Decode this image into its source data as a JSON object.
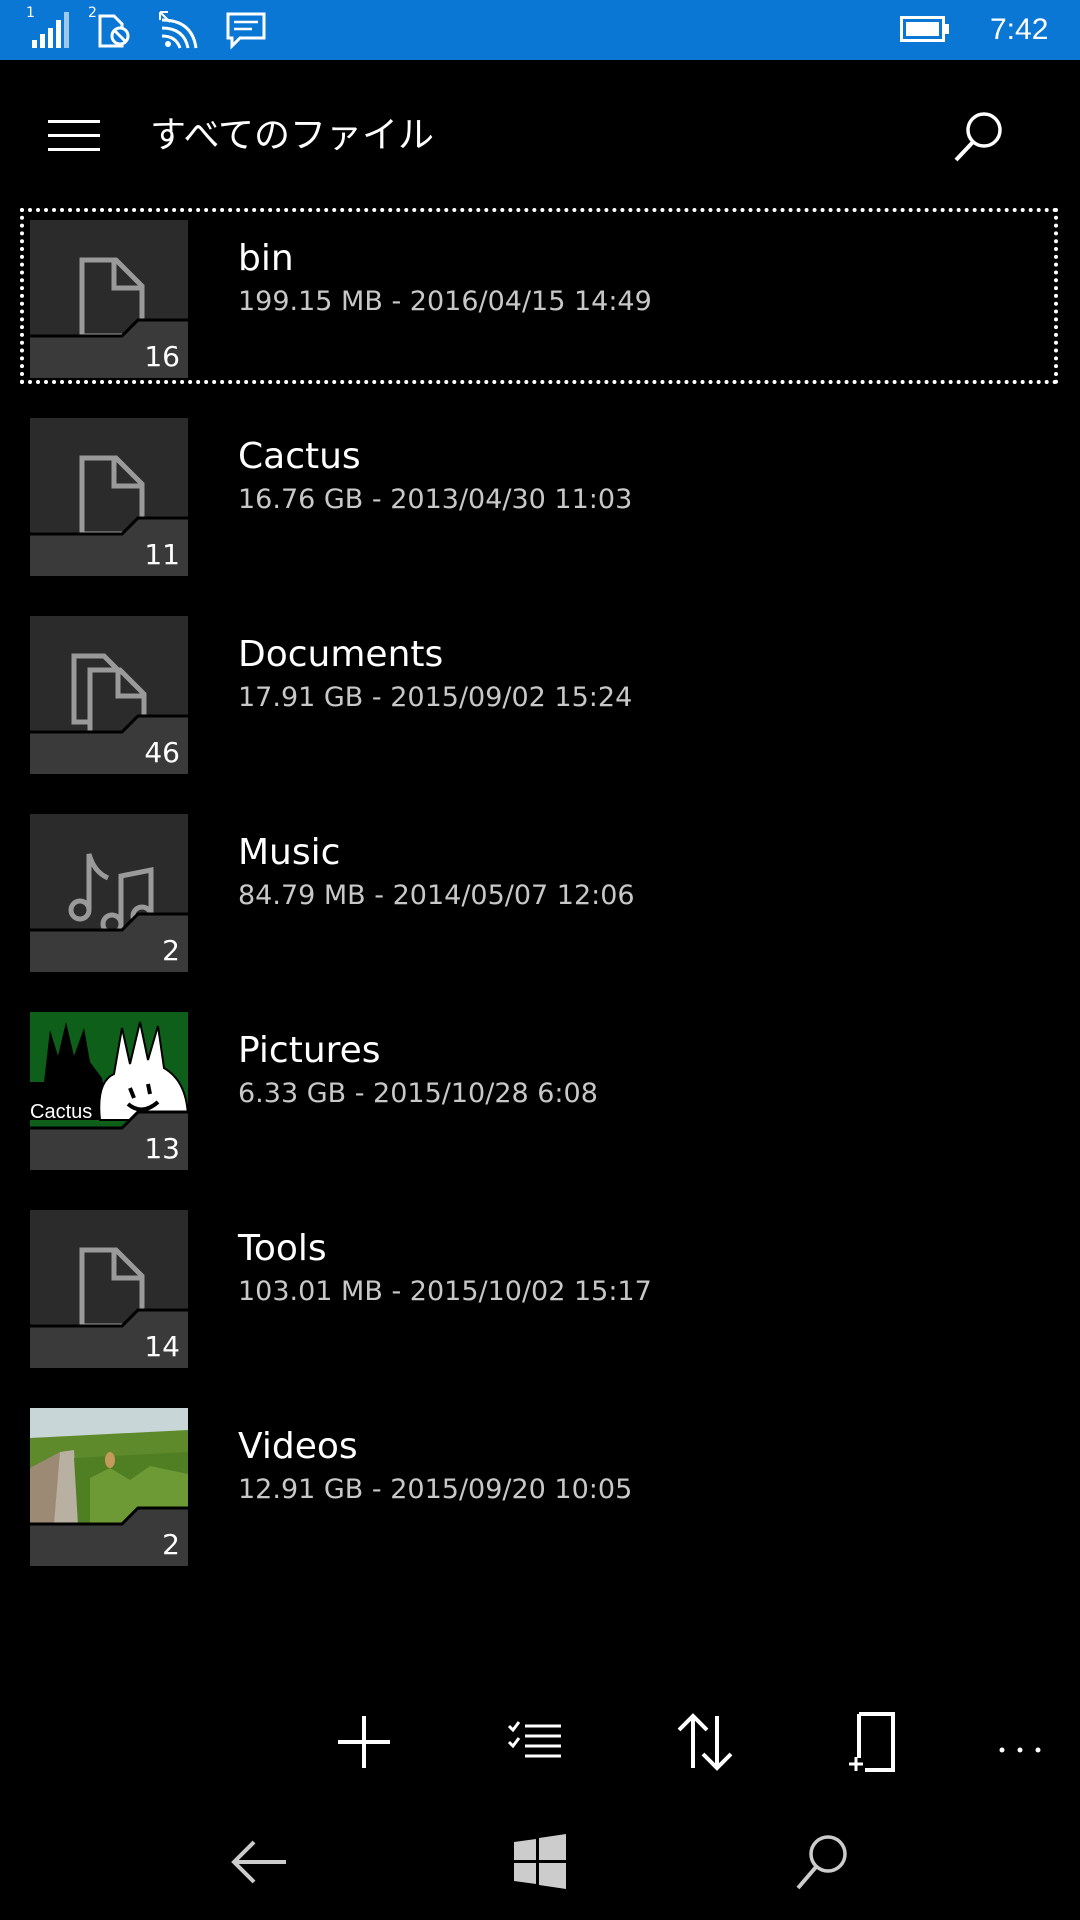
{
  "status_bar": {
    "sim1_label": "1",
    "sim2_label": "2",
    "time": "7:42",
    "icons": [
      "signal-icon",
      "sim2-data-icon",
      "wifi-icon",
      "message-icon",
      "battery-icon"
    ]
  },
  "header": {
    "title": "すべてのファイル",
    "menu_icon": "hamburger-icon",
    "search_icon": "search-icon"
  },
  "files": [
    {
      "name": "bin",
      "meta": "199.15 MB - 2016/04/15 14:49",
      "count": "16",
      "icon": "file-icon"
    },
    {
      "name": "Cactus",
      "meta": "16.76 GB - 2013/04/30 11:03",
      "count": "11",
      "icon": "file-icon"
    },
    {
      "name": "Documents",
      "meta": "17.91 GB - 2015/09/02 15:24",
      "count": "46",
      "icon": "documents-icon"
    },
    {
      "name": "Music",
      "meta": "84.79 MB - 2014/05/07 12:06",
      "count": "2",
      "icon": "music-icon"
    },
    {
      "name": "Pictures",
      "meta": "6.33 GB - 2015/10/28 6:08",
      "count": "13",
      "icon": "cactus-logo-thumbnail",
      "thumb_text": "Cactus"
    },
    {
      "name": "Tools",
      "meta": "103.01 MB - 2015/10/02 15:17",
      "count": "14",
      "icon": "file-icon"
    },
    {
      "name": "Videos",
      "meta": "12.91 GB - 2015/09/20 10:05",
      "count": "2",
      "icon": "video-thumbnail"
    }
  ],
  "command_bar": {
    "icons": [
      "add-icon",
      "select-list-icon",
      "sort-icon",
      "new-file-icon",
      "more-icon"
    ]
  },
  "nav_bar": {
    "icons": [
      "back-icon",
      "windows-icon",
      "search-icon"
    ]
  },
  "colors": {
    "accent": "#0a77d4",
    "background": "#000000",
    "tile": "#2b2b2b",
    "meta_text": "#c8c8c8"
  }
}
